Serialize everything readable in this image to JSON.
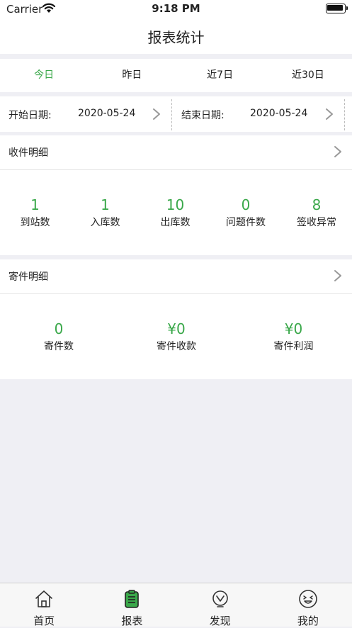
{
  "status": {
    "carrier": "Carrier",
    "time": "9:18 PM"
  },
  "nav": {
    "title": "报表统计"
  },
  "tabs": [
    {
      "label": "今日",
      "active": true
    },
    {
      "label": "昨日",
      "active": false
    },
    {
      "label": "近7日",
      "active": false
    },
    {
      "label": "近30日",
      "active": false
    }
  ],
  "dates": {
    "start_label": "开始日期:",
    "start_value": "2020-05-24",
    "end_label": "结束日期:",
    "end_value": "2020-05-24"
  },
  "receive": {
    "title": "收件明细",
    "stats": [
      {
        "value": "1",
        "label": "到站数"
      },
      {
        "value": "1",
        "label": "入库数"
      },
      {
        "value": "10",
        "label": "出库数"
      },
      {
        "value": "0",
        "label": "问题件数"
      },
      {
        "value": "8",
        "label": "签收异常"
      }
    ]
  },
  "send": {
    "title": "寄件明细",
    "stats": [
      {
        "value": "0",
        "label": "寄件数"
      },
      {
        "value": "¥0",
        "label": "寄件收款"
      },
      {
        "value": "¥0",
        "label": "寄件利润"
      }
    ]
  },
  "tabbar": [
    {
      "label": "首页",
      "icon": "home-icon"
    },
    {
      "label": "报表",
      "icon": "report-icon",
      "active": true
    },
    {
      "label": "发现",
      "icon": "discover-icon"
    },
    {
      "label": "我的",
      "icon": "smiley-icon"
    }
  ],
  "colors": {
    "accent": "#3aa84a"
  }
}
